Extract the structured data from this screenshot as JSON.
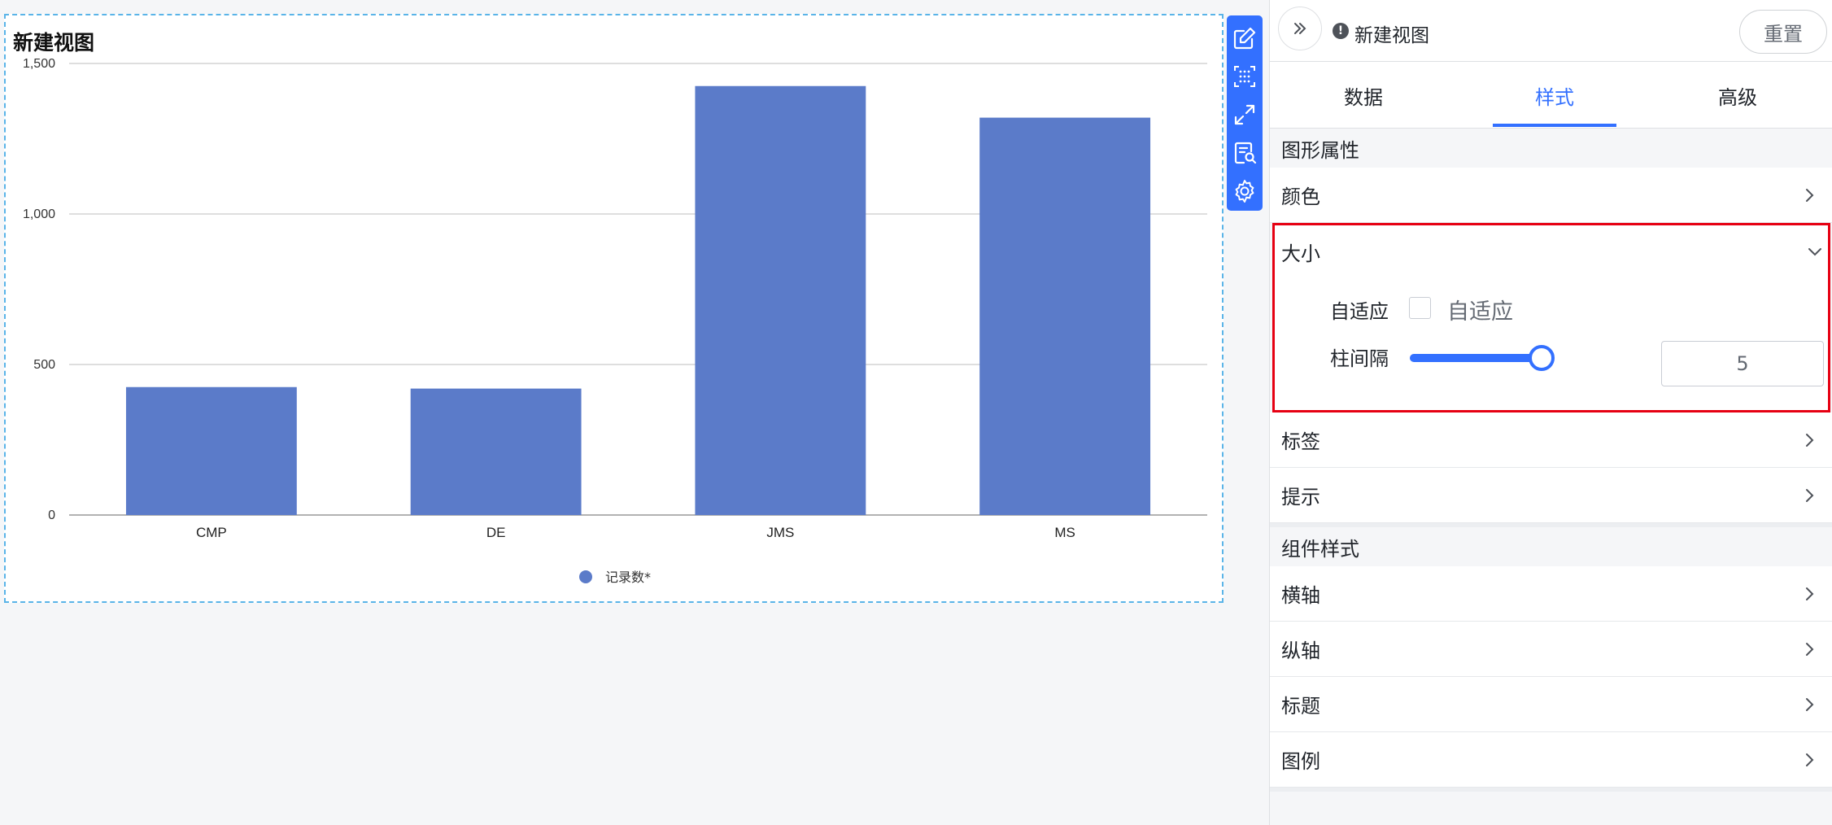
{
  "chart": {
    "title": "新建视图"
  },
  "chart_data": {
    "type": "bar",
    "categories": [
      "CMP",
      "DE",
      "JMS",
      "MS"
    ],
    "series": [
      {
        "name": "记录数*",
        "values": [
          425,
          420,
          1425,
          1320
        ]
      }
    ],
    "yticks": [
      0,
      500,
      1000,
      1500
    ],
    "ytick_labels": [
      "0",
      "500",
      "1,000",
      "1,500"
    ],
    "ylim": [
      0,
      1500
    ],
    "grid": true,
    "legend": "bottom-center",
    "bar_color": "#5b7bc9"
  },
  "toolbar": {
    "icons": [
      "edit-icon",
      "grid-icon",
      "expand-icon",
      "inspect-icon",
      "settings-icon"
    ]
  },
  "panel": {
    "view_name": "新建视图",
    "reset_label": "重置",
    "tabs": [
      {
        "label": "数据"
      },
      {
        "label": "样式"
      },
      {
        "label": "高级"
      }
    ],
    "active_tab": 1,
    "sections": {
      "graphic": "图形属性",
      "component": "组件样式"
    },
    "rows": {
      "color": "颜色",
      "size": "大小",
      "label": "标签",
      "tooltip": "提示",
      "xaxis": "横轴",
      "yaxis": "纵轴",
      "title": "标题",
      "legend": "图例"
    },
    "size": {
      "adaptive_label": "自适应",
      "adaptive_checkbox_label": "自适应",
      "adaptive_checked": false,
      "spacing_label": "柱间隔",
      "spacing_value": "5",
      "spacing_fraction": 0.92
    },
    "accent_color": "#3370ff",
    "highlight_color": "#e60012"
  }
}
